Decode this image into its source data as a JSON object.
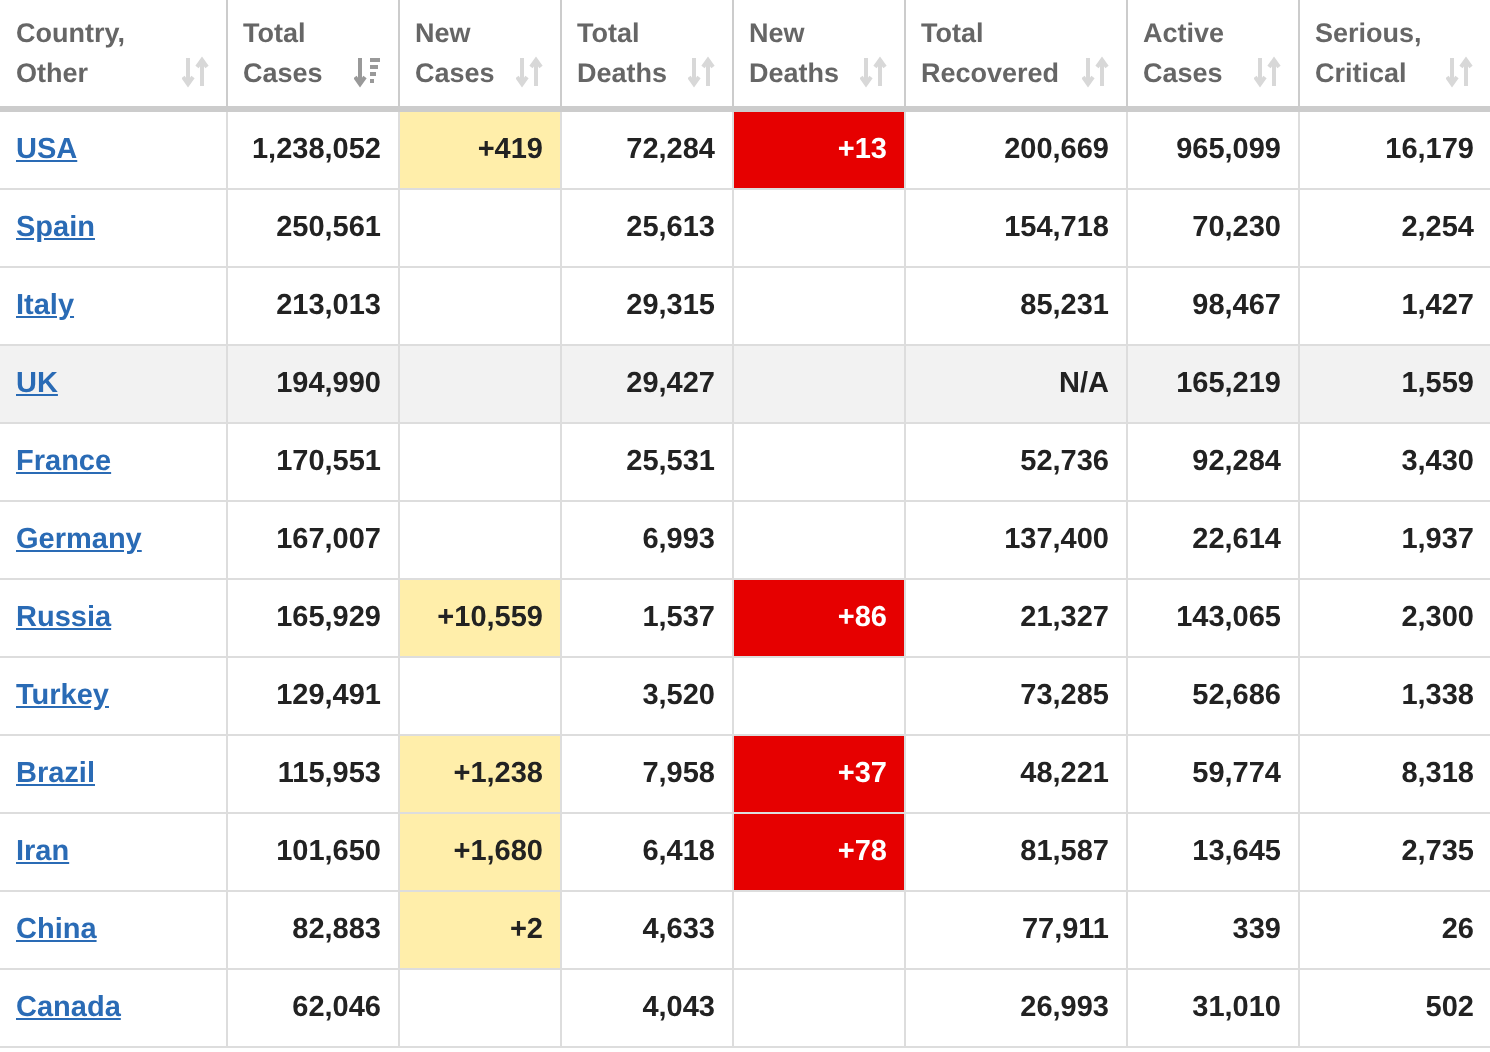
{
  "table": {
    "columns": [
      {
        "label": "Country,\nOther",
        "sorted": false
      },
      {
        "label": "Total\nCases",
        "sorted": true
      },
      {
        "label": "New\nCases",
        "sorted": false
      },
      {
        "label": "Total\nDeaths",
        "sorted": false
      },
      {
        "label": "New\nDeaths",
        "sorted": false
      },
      {
        "label": "Total\nRecovered",
        "sorted": false
      },
      {
        "label": "Active\nCases",
        "sorted": false
      },
      {
        "label": "Serious,\nCritical",
        "sorted": false
      }
    ],
    "rows": [
      {
        "country": "USA",
        "total_cases": "1,238,052",
        "new_cases": "+419",
        "total_deaths": "72,284",
        "new_deaths": "+13",
        "total_recovered": "200,669",
        "active_cases": "965,099",
        "serious_critical": "16,179",
        "selected": false
      },
      {
        "country": "Spain",
        "total_cases": "250,561",
        "new_cases": "",
        "total_deaths": "25,613",
        "new_deaths": "",
        "total_recovered": "154,718",
        "active_cases": "70,230",
        "serious_critical": "2,254",
        "selected": false
      },
      {
        "country": "Italy",
        "total_cases": "213,013",
        "new_cases": "",
        "total_deaths": "29,315",
        "new_deaths": "",
        "total_recovered": "85,231",
        "active_cases": "98,467",
        "serious_critical": "1,427",
        "selected": false
      },
      {
        "country": "UK",
        "total_cases": "194,990",
        "new_cases": "",
        "total_deaths": "29,427",
        "new_deaths": "",
        "total_recovered": "N/A",
        "active_cases": "165,219",
        "serious_critical": "1,559",
        "selected": true
      },
      {
        "country": "France",
        "total_cases": "170,551",
        "new_cases": "",
        "total_deaths": "25,531",
        "new_deaths": "",
        "total_recovered": "52,736",
        "active_cases": "92,284",
        "serious_critical": "3,430",
        "selected": false
      },
      {
        "country": "Germany",
        "total_cases": "167,007",
        "new_cases": "",
        "total_deaths": "6,993",
        "new_deaths": "",
        "total_recovered": "137,400",
        "active_cases": "22,614",
        "serious_critical": "1,937",
        "selected": false
      },
      {
        "country": "Russia",
        "total_cases": "165,929",
        "new_cases": "+10,559",
        "total_deaths": "1,537",
        "new_deaths": "+86",
        "total_recovered": "21,327",
        "active_cases": "143,065",
        "serious_critical": "2,300",
        "selected": false
      },
      {
        "country": "Turkey",
        "total_cases": "129,491",
        "new_cases": "",
        "total_deaths": "3,520",
        "new_deaths": "",
        "total_recovered": "73,285",
        "active_cases": "52,686",
        "serious_critical": "1,338",
        "selected": false
      },
      {
        "country": "Brazil",
        "total_cases": "115,953",
        "new_cases": "+1,238",
        "total_deaths": "7,958",
        "new_deaths": "+37",
        "total_recovered": "48,221",
        "active_cases": "59,774",
        "serious_critical": "8,318",
        "selected": false
      },
      {
        "country": "Iran",
        "total_cases": "101,650",
        "new_cases": "+1,680",
        "total_deaths": "6,418",
        "new_deaths": "+78",
        "total_recovered": "81,587",
        "active_cases": "13,645",
        "serious_critical": "2,735",
        "selected": false
      },
      {
        "country": "China",
        "total_cases": "82,883",
        "new_cases": "+2",
        "total_deaths": "4,633",
        "new_deaths": "",
        "total_recovered": "77,911",
        "active_cases": "339",
        "serious_critical": "26",
        "selected": false
      },
      {
        "country": "Canada",
        "total_cases": "62,046",
        "new_cases": "",
        "total_deaths": "4,043",
        "new_deaths": "",
        "total_recovered": "26,993",
        "active_cases": "31,010",
        "serious_critical": "502",
        "selected": false
      }
    ]
  }
}
